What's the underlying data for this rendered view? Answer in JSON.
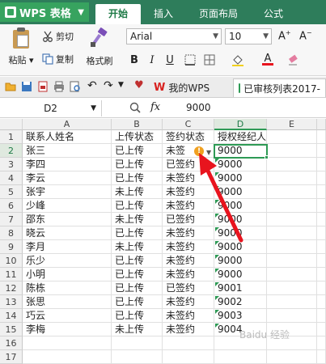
{
  "app": {
    "title": "WPS 表格"
  },
  "tabs": [
    "开始",
    "插入",
    "页面布局",
    "公式"
  ],
  "active_tab": "开始",
  "ribbon": {
    "paste": "粘贴",
    "cut": "剪切",
    "copy": "复制",
    "format_painter": "格式刷",
    "font_name": "Arial",
    "font_size": "10",
    "bold": "B",
    "italic": "I",
    "underline": "U",
    "font_color": "A"
  },
  "doc_tabs": [
    "我的WPS",
    "已审核列表2017-"
  ],
  "formula_bar": {
    "name_box": "D2",
    "fx": "fx",
    "value": "9000"
  },
  "columns": [
    "A",
    "B",
    "C",
    "D",
    "E"
  ],
  "rows": [
    "1",
    "2",
    "3",
    "4",
    "5",
    "6",
    "7",
    "8",
    "9",
    "10",
    "11",
    "12",
    "13",
    "14",
    "15",
    "16",
    "17"
  ],
  "table": [
    [
      "联系人姓名",
      "上传状态",
      "签约状态",
      "授权经纪人"
    ],
    [
      "张三",
      "已上传",
      "未签",
      "9000"
    ],
    [
      "李四",
      "已上传",
      "已签约",
      "9000"
    ],
    [
      "李云",
      "已上传",
      "未签约",
      "9000"
    ],
    [
      "张宇",
      "未上传",
      "未签约",
      "9000"
    ],
    [
      "少峰",
      "已上传",
      "未签约",
      "9000"
    ],
    [
      "邵东",
      "未上传",
      "已签约",
      "9000"
    ],
    [
      "晓云",
      "已上传",
      "未签约",
      "9000"
    ],
    [
      "李月",
      "未上传",
      "未签约",
      "9000"
    ],
    [
      "乐少",
      "已上传",
      "未签约",
      "9000"
    ],
    [
      "小明",
      "已上传",
      "未签约",
      "9000"
    ],
    [
      "陈栋",
      "已上传",
      "已签约",
      "9001"
    ],
    [
      "张思",
      "已上传",
      "未签约",
      "9002"
    ],
    [
      "巧云",
      "已上传",
      "未签约",
      "9003"
    ],
    [
      "李梅",
      "未上传",
      "未签约",
      "9004"
    ]
  ],
  "warning_badge": "!",
  "watermark": "Baidu 经验",
  "colors": {
    "title_bar": "#2e7d5b",
    "accent": "#2e9a55",
    "arrow": "#e8141e"
  }
}
